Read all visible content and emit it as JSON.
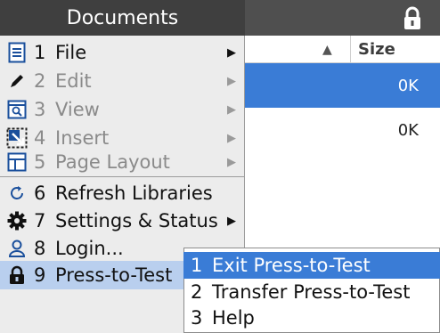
{
  "background": {
    "size_header": "Size",
    "sort_arrow": "▲",
    "rows": [
      {
        "size": "0K"
      },
      {
        "size": "0K"
      }
    ]
  },
  "documents_menu": {
    "title": "Documents",
    "items": [
      {
        "num": "1",
        "label": "File",
        "arrow": "▶"
      },
      {
        "num": "2",
        "label": "Edit",
        "arrow": "▶"
      },
      {
        "num": "3",
        "label": "View",
        "arrow": "▶"
      },
      {
        "num": "4",
        "label": "Insert",
        "arrow": "▶"
      },
      {
        "num": "5",
        "label": "Page Layout",
        "arrow": "▶"
      },
      {
        "num": "6",
        "label": "Refresh Libraries"
      },
      {
        "num": "7",
        "label": "Settings & Status",
        "arrow": "▶"
      },
      {
        "num": "8",
        "label": "Login..."
      },
      {
        "num": "9",
        "label": "Press-to-Test"
      }
    ]
  },
  "press_to_test_submenu": {
    "items": [
      {
        "num": "1",
        "label": "Exit Press-to-Test"
      },
      {
        "num": "2",
        "label": "Transfer Press-to-Test"
      },
      {
        "num": "3",
        "label": "Help"
      }
    ]
  },
  "colors": {
    "selection": "#3a7cd6",
    "menu_title": "#3f3f3f",
    "menu_bg": "#ececec"
  }
}
